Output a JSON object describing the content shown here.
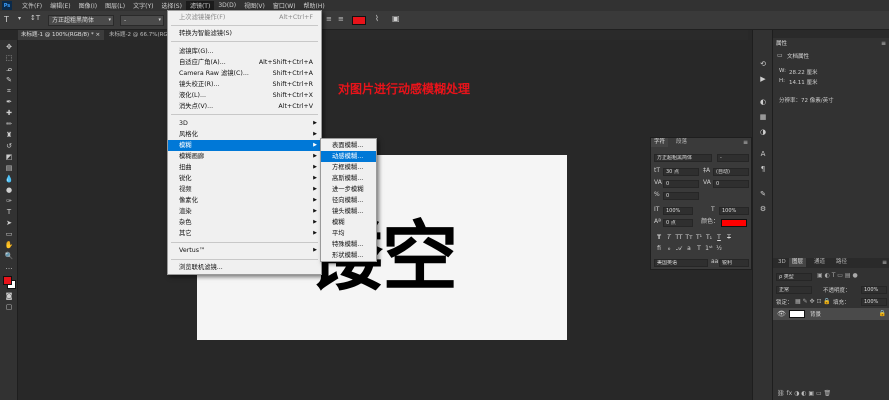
{
  "menubar": {
    "logo": "Ps",
    "items": [
      "文件(F)",
      "编辑(E)",
      "图像(I)",
      "图层(L)",
      "文字(Y)",
      "选择(S)",
      "滤镜(T)",
      "3D(D)",
      "视图(V)",
      "窗口(W)",
      "帮助(H)"
    ]
  },
  "options": {
    "font_family": "方正超粗黑简体",
    "font_style": "-"
  },
  "tabs": [
    {
      "label": "未标题-1 @ 100%(RGB/8) *"
    },
    {
      "label": "未标题-2 @ 66.7%(RGB/8)"
    }
  ],
  "filter_menu": {
    "items": [
      {
        "label": "上次滤镜操作(F)",
        "shortcut": "Alt+Ctrl+F",
        "disabled": true
      },
      {
        "label": "转换为智能滤镜(S)",
        "shortcut": ""
      },
      {
        "label": "滤镜库(G)...",
        "shortcut": ""
      },
      {
        "label": "自适应广角(A)...",
        "shortcut": "Alt+Shift+Ctrl+A"
      },
      {
        "label": "Camera Raw 滤镜(C)...",
        "shortcut": "Shift+Ctrl+A"
      },
      {
        "label": "镜头校正(R)...",
        "shortcut": "Shift+Ctrl+R"
      },
      {
        "label": "液化(L)...",
        "shortcut": "Shift+Ctrl+X"
      },
      {
        "label": "消失点(V)...",
        "shortcut": "Alt+Ctrl+V"
      },
      {
        "label": "3D",
        "submenu": true
      },
      {
        "label": "风格化",
        "submenu": true
      },
      {
        "label": "模糊",
        "submenu": true,
        "highlight": true
      },
      {
        "label": "模糊画廊",
        "submenu": true
      },
      {
        "label": "扭曲",
        "submenu": true
      },
      {
        "label": "锐化",
        "submenu": true
      },
      {
        "label": "视频",
        "submenu": true
      },
      {
        "label": "像素化",
        "submenu": true
      },
      {
        "label": "渲染",
        "submenu": true
      },
      {
        "label": "杂色",
        "submenu": true
      },
      {
        "label": "其它",
        "submenu": true
      },
      {
        "label": "Vertus™",
        "submenu": true
      },
      {
        "label": "浏览联机滤镜...",
        "shortcut": ""
      }
    ]
  },
  "blur_menu": {
    "items": [
      "表面模糊...",
      "动感模糊...",
      "方框模糊...",
      "高斯模糊...",
      "进一步模糊",
      "径向模糊...",
      "镜头模糊...",
      "模糊",
      "平均",
      "特殊模糊...",
      "形状模糊..."
    ],
    "highlight_index": 1
  },
  "canvas": {
    "big_text": "镂空",
    "caption": "对图片进行动感模糊处理"
  },
  "properties": {
    "title": "属性",
    "subtitle": "文档属性",
    "width_label": "W:",
    "width_value": "28.22 厘米",
    "height_label": "H:",
    "height_value": "14.11 厘米",
    "resolution": "分辨率：72 像素/英寸"
  },
  "character": {
    "tab1": "字符",
    "tab2": "段落",
    "font_family": "方正超粗黑简体",
    "font_style": "-",
    "size": "30 点",
    "leading": "(自动)",
    "kerning": "0",
    "tracking": "0",
    "vscale": "100%",
    "hscale": "100%",
    "baseline": "0 点",
    "color_label": "颜色：",
    "color": "#ff0000",
    "language": "美国英语",
    "aa_label": "aa",
    "antialias": "锐利"
  },
  "layers": {
    "tabs": [
      "3D",
      "图层",
      "通道",
      "路径"
    ],
    "kind": "正常",
    "opacity_label": "不透明度：",
    "opacity": "100%",
    "lock_label": "锁定：",
    "fill_label": "填充：",
    "fill": "100%",
    "layer_name": "背景"
  },
  "colors": {
    "foreground": "#e8131a",
    "background": "#ffffff",
    "highlight": "#0078d7",
    "caption": "#e8131a"
  }
}
